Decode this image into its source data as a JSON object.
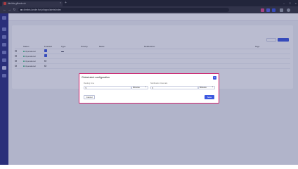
{
  "browser": {
    "tab_title": "dimitris.gilberto.uk",
    "tab_close": "×",
    "new_tab": "+",
    "url": "dimitris.lander.farl.pt/apps/alerts/index",
    "nav": {
      "back": "←",
      "forward": "→",
      "reload": "↻"
    },
    "window_controls": [
      "–",
      "□",
      "×"
    ],
    "extension_colors": [
      "#e04a8c",
      "#5a63e8",
      "#3d58e0",
      "#9aa0a6",
      "#9aa0a6"
    ]
  },
  "app": {
    "breadcrumbs": [
      "",
      ""
    ],
    "section_title": "",
    "table": {
      "headers": [
        "",
        "Status",
        "Enabled",
        "Type",
        "Priority",
        "Name",
        "Notification",
        "",
        "Tags"
      ],
      "rows": [
        {
          "status": "Operational",
          "enabled": true,
          "type": "",
          "priority": "",
          "name": "",
          "notification": "",
          "tags": ""
        },
        {
          "status": "Operational",
          "enabled": true,
          "type": "",
          "priority": "",
          "name": "",
          "notification": "",
          "tags": ""
        },
        {
          "status": "Operational",
          "enabled": false,
          "type": "",
          "priority": "",
          "name": "",
          "notification": "",
          "tags": ""
        },
        {
          "status": "Operational",
          "enabled": false,
          "type": "",
          "priority": "",
          "name": "",
          "notification": "",
          "tags": ""
        }
      ]
    },
    "colors": {
      "accent": "#3d58e0",
      "sidebar": "#2b3080",
      "modal_border": "#d0216e",
      "status_ok": "#2bb673"
    }
  },
  "modal": {
    "title": "Global alert configuration",
    "close_icon": "close-icon",
    "resting_label": "Resting time",
    "resting_value": "5",
    "resting_unit": "Minutes",
    "notification_label": "Notification Intervals",
    "notification_value": "5",
    "notification_unit": "Minutes",
    "cancel_label": "Cancel",
    "save_label": "Save"
  }
}
